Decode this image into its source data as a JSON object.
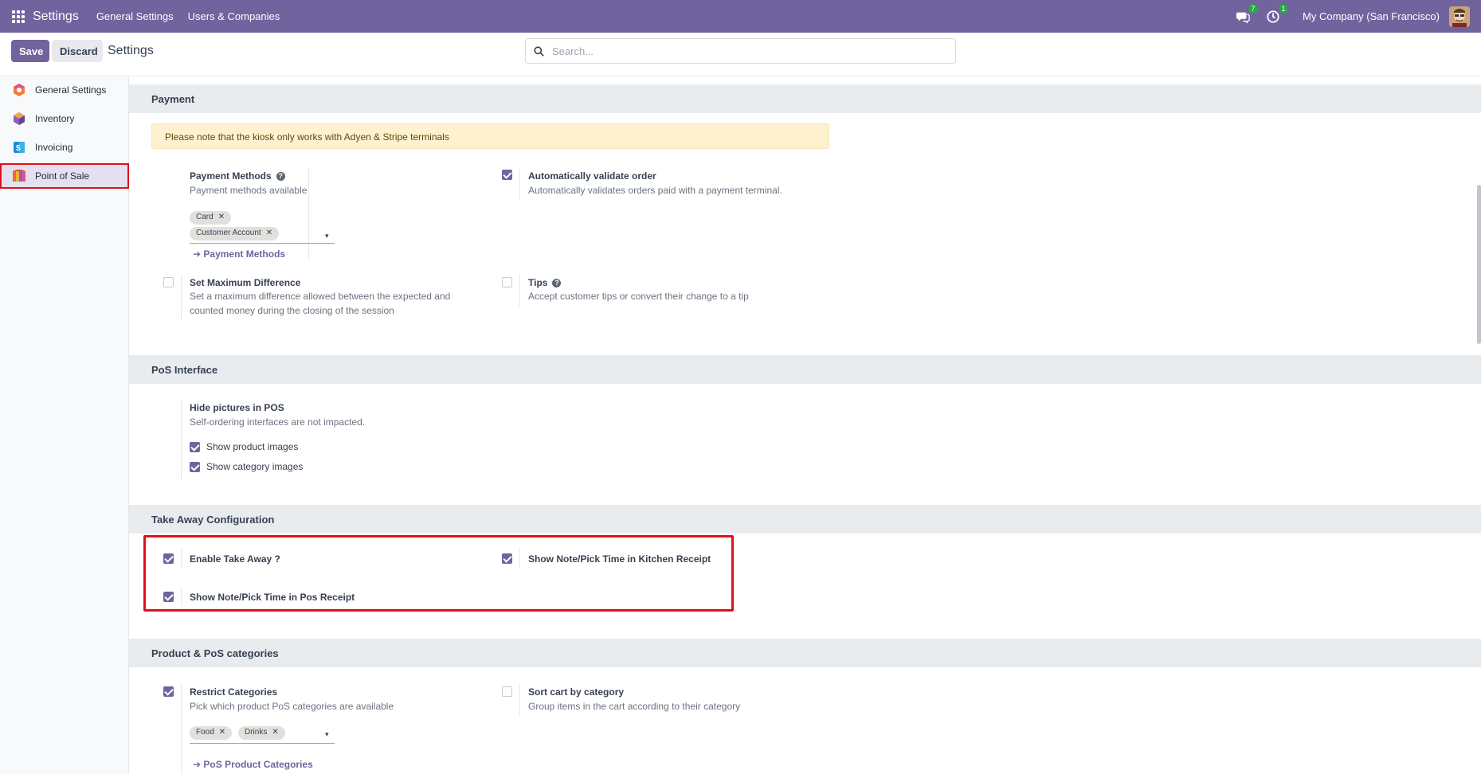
{
  "navbar": {
    "brand": "Settings",
    "menus": [
      "General Settings",
      "Users & Companies"
    ],
    "messages_count": "7",
    "activity_count": "1",
    "company": "My Company (San Francisco)"
  },
  "control_panel": {
    "save_label": "Save",
    "discard_label": "Discard",
    "title": "Settings",
    "search_placeholder": "Search..."
  },
  "sidebar": {
    "items": [
      {
        "label": "General Settings",
        "icon": "general-settings-icon"
      },
      {
        "label": "Inventory",
        "icon": "inventory-icon"
      },
      {
        "label": "Invoicing",
        "icon": "invoicing-icon"
      },
      {
        "label": "Point of Sale",
        "icon": "point-of-sale-icon"
      }
    ]
  },
  "payment": {
    "header": "Payment",
    "alert": "Please note that the kiosk only works with Adyen & Stripe terminals",
    "payment_methods": {
      "title": "Payment Methods",
      "desc": "Payment methods available",
      "tags": [
        "Card",
        "Customer Account"
      ],
      "link": "Payment Methods"
    },
    "auto_validate": {
      "title": "Automatically validate order",
      "desc": "Automatically validates orders paid with a payment terminal.",
      "checked": true
    },
    "max_diff": {
      "title": "Set Maximum Difference",
      "desc": "Set a maximum difference allowed between the expected and counted money during the closing of the session",
      "checked": false
    },
    "tips": {
      "title": "Tips",
      "desc": "Accept customer tips or convert their change to a tip",
      "checked": false
    }
  },
  "pos_interface": {
    "header": "PoS Interface",
    "hide_pictures": {
      "title": "Hide pictures in POS",
      "desc": "Self-ordering interfaces are not impacted."
    },
    "show_product_images": {
      "label": "Show product images",
      "checked": true
    },
    "show_category_images": {
      "label": "Show category images",
      "checked": true
    }
  },
  "take_away": {
    "header": "Take Away Configuration",
    "enable": {
      "title": "Enable Take Away ?",
      "checked": true
    },
    "kitchen_receipt": {
      "title": "Show Note/Pick Time in Kitchen Receipt",
      "checked": true
    },
    "pos_receipt": {
      "title": "Show Note/Pick Time in Pos Receipt",
      "checked": true
    }
  },
  "product_categories": {
    "header": "Product & PoS categories",
    "restrict": {
      "title": "Restrict Categories",
      "desc": "Pick which product PoS categories are available",
      "checked": true,
      "tags": [
        "Food",
        "Drinks"
      ],
      "link": "PoS Product Categories"
    },
    "sort_cart": {
      "title": "Sort cart by category",
      "desc": "Group items in the cart according to their category",
      "checked": false
    }
  },
  "colors": {
    "brand": "#71639e",
    "highlight": "#e0101a",
    "section_bg": "#e9ecef",
    "alert_bg": "#fdf1cf"
  }
}
